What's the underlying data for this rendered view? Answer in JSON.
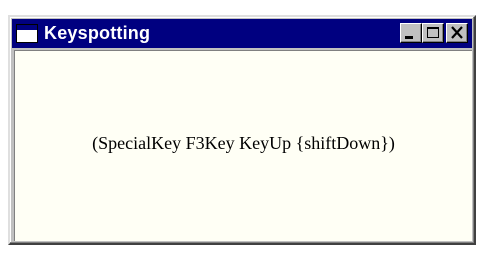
{
  "window": {
    "title": "Keyspotting",
    "icon": "window-app-icon",
    "buttons": [
      {
        "name": "minimize",
        "icon": "minimize-icon"
      },
      {
        "name": "maximize",
        "icon": "maximize-icon"
      },
      {
        "name": "close",
        "icon": "close-icon"
      }
    ]
  },
  "content": {
    "key_event_text": "(SpecialKey F3Key KeyUp {shiftDown})"
  },
  "colors": {
    "titlebar": "#000080",
    "frame": "#c0c0c0",
    "client_background": "#fffff5"
  }
}
